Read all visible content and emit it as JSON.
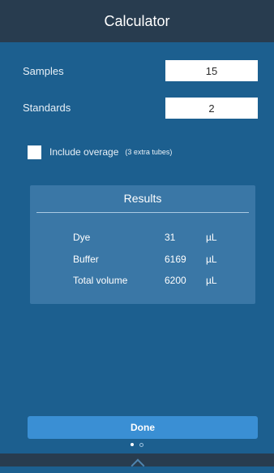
{
  "header": {
    "title": "Calculator"
  },
  "inputs": {
    "samples": {
      "label": "Samples",
      "value": "15"
    },
    "standards": {
      "label": "Standards",
      "value": "2"
    }
  },
  "overage": {
    "label": "Include overage",
    "note": "(3 extra tubes)",
    "checked": false
  },
  "results": {
    "title": "Results",
    "rows": [
      {
        "name": "Dye",
        "value": "31",
        "unit": "µL"
      },
      {
        "name": "Buffer",
        "value": "6169",
        "unit": "µL"
      },
      {
        "name": "Total volume",
        "value": "6200",
        "unit": "µL"
      }
    ]
  },
  "footer": {
    "done_label": "Done",
    "page_index": 1,
    "page_count": 2
  },
  "colors": {
    "background": "#1c5f8f",
    "titlebar": "#283c4f",
    "results_panel": "#3a77a6",
    "button": "#3a8fd4"
  }
}
